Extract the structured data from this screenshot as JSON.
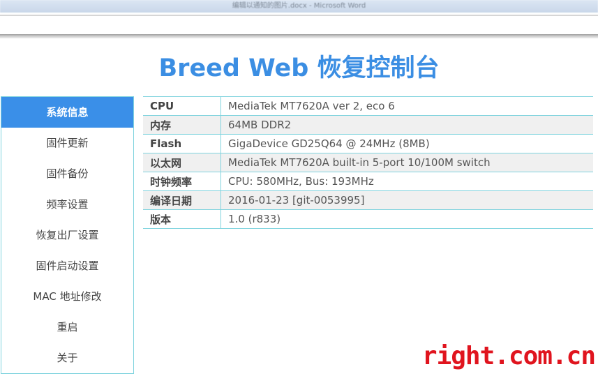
{
  "window": {
    "title": "编辑以通知的图片.docx - Microsoft Word"
  },
  "header": {
    "title": "Breed Web 恢复控制台"
  },
  "sidebar": {
    "items": [
      {
        "label": "系统信息",
        "active": true
      },
      {
        "label": "固件更新"
      },
      {
        "label": "固件备份"
      },
      {
        "label": "频率设置"
      },
      {
        "label": "恢复出厂设置"
      },
      {
        "label": "固件启动设置"
      },
      {
        "label": "MAC 地址修改"
      },
      {
        "label": "重启"
      },
      {
        "label": "关于"
      }
    ]
  },
  "system_info": {
    "rows": [
      {
        "key": "CPU",
        "value": "MediaTek MT7620A ver 2, eco 6"
      },
      {
        "key": "内存",
        "value": "64MB DDR2"
      },
      {
        "key": "Flash",
        "value": "GigaDevice GD25Q64 @ 24MHz (8MB)"
      },
      {
        "key": "以太网",
        "value": "MediaTek MT7620A built-in 5-port 10/100M switch"
      },
      {
        "key": "时钟频率",
        "value": "CPU: 580MHz, Bus: 193MHz"
      },
      {
        "key": "编译日期",
        "value": "2016-01-23 [git-0053995]"
      },
      {
        "key": "版本",
        "value": "1.0 (r833)"
      }
    ]
  },
  "watermark": {
    "text": "right.com.cn",
    "color": "#e0141e"
  },
  "colors": {
    "accent": "#3a8fe8",
    "title": "#3b8ee3",
    "border": "#7fd3de"
  }
}
